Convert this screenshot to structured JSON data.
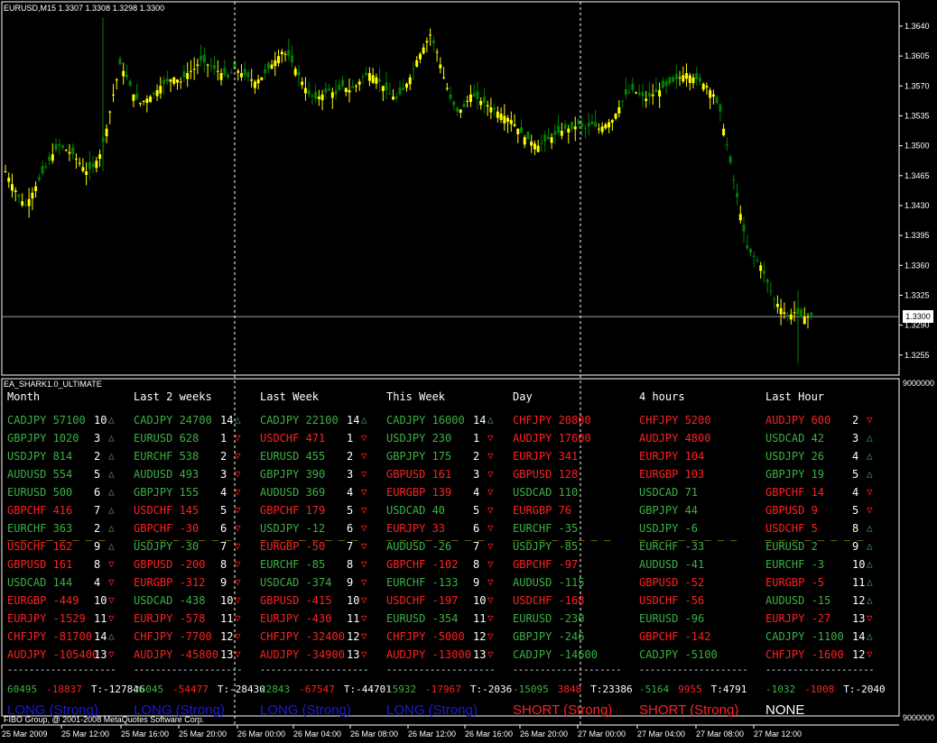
{
  "window": {
    "chart_header": "EURUSD,M15  1.3307 1.3308 1.3298 1.3300",
    "indicator_title": "EA_SHARK1.0_ULTIMATE",
    "copyright": "FIBO Group, @ 2001-2008 MetaQuotes Software Corp.",
    "current_price_badge": "1.3300",
    "indicator_axis_top": "9000000",
    "indicator_axis_bottom": "9000000"
  },
  "colors": {
    "bull": "#ffff00",
    "bear": "#008000",
    "up": "#3cb043",
    "down": "#ff2020",
    "long": "#1a1adc",
    "short": "#ff2020",
    "none": "#ffffff"
  },
  "chart_data": {
    "type": "candlestick",
    "symbol": "EURUSD",
    "timeframe": "M15",
    "y_ticks": [
      "1.3640",
      "1.3605",
      "1.3570",
      "1.3535",
      "1.3500",
      "1.3465",
      "1.3430",
      "1.3395",
      "1.3360",
      "1.3325",
      "1.3290",
      "1.3255"
    ],
    "ylim": [
      1.324,
      1.366
    ],
    "x_ticks": [
      "25 Mar 2009",
      "25 Mar 12:00",
      "25 Mar 16:00",
      "25 Mar 20:00",
      "26 Mar 00:00",
      "26 Mar 04:00",
      "26 Mar 08:00",
      "26 Mar 12:00",
      "26 Mar 16:00",
      "26 Mar 20:00",
      "27 Mar 00:00",
      "27 Mar 04:00",
      "27 Mar 08:00",
      "27 Mar 12:00"
    ],
    "close_path": [
      1.347,
      1.3455,
      1.344,
      1.343,
      1.3445,
      1.346,
      1.3475,
      1.349,
      1.35,
      1.3495,
      1.349,
      1.348,
      1.347,
      1.3475,
      1.349,
      1.352,
      1.356,
      1.3595,
      1.358,
      1.356,
      1.355,
      1.3555,
      1.356,
      1.357,
      1.3575,
      1.358,
      1.3575,
      1.3585,
      1.359,
      1.36,
      1.3595,
      1.359,
      1.3585,
      1.358,
      1.359,
      1.3585,
      1.358,
      1.3575,
      1.358,
      1.359,
      1.36,
      1.361,
      1.3605,
      1.359,
      1.3575,
      1.356,
      1.3555,
      1.356,
      1.3565,
      1.356,
      1.357,
      1.3565,
      1.357,
      1.358,
      1.3585,
      1.358,
      1.357,
      1.356,
      1.3555,
      1.3565,
      1.358,
      1.36,
      1.3615,
      1.363,
      1.361,
      1.358,
      1.3555,
      1.354,
      1.3545,
      1.356,
      1.3555,
      1.355,
      1.3545,
      1.354,
      1.3535,
      1.353,
      1.352,
      1.351,
      1.3505,
      1.35,
      1.3505,
      1.351,
      1.3515,
      1.352,
      1.352,
      1.3525,
      1.352,
      1.3525,
      1.352,
      1.3525,
      1.353,
      1.3545,
      1.356,
      1.3565,
      1.356,
      1.3555,
      1.356,
      1.3565,
      1.357,
      1.3575,
      1.358,
      1.3585,
      1.358,
      1.3575,
      1.357,
      1.356,
      1.354,
      1.35,
      1.346,
      1.342,
      1.338,
      1.337,
      1.336,
      1.334,
      1.332,
      1.331,
      1.33,
      1.3305,
      1.33,
      1.33
    ]
  },
  "columns": [
    {
      "header": "Month",
      "rows": [
        {
          "pair": "CADJPY 57100",
          "rank": "10",
          "dir": "up"
        },
        {
          "pair": "GBPJPY 1020",
          "rank": "3",
          "dir": "up"
        },
        {
          "pair": "USDJPY 814",
          "rank": "2",
          "dir": "up"
        },
        {
          "pair": "AUDUSD 554",
          "rank": "5",
          "dir": "up"
        },
        {
          "pair": "EURUSD 500",
          "rank": "6",
          "dir": "up"
        },
        {
          "pair": "GBPCHF 416",
          "rank": "7",
          "dir": "up"
        },
        {
          "pair": "EURCHF 363",
          "rank": "2",
          "dir": "up"
        },
        {
          "pair": "USDCHF 162",
          "rank": "9",
          "dir": "up"
        },
        {
          "pair": "GBPUSD 161",
          "rank": "8",
          "dir": "down"
        },
        {
          "pair": "USDCAD 144",
          "rank": "4",
          "dir": "down"
        },
        {
          "pair": "EURGBP -449",
          "rank": "10",
          "dir": "down"
        },
        {
          "pair": "EURJPY -1529",
          "rank": "11",
          "dir": "down"
        },
        {
          "pair": "CHFJPY -81700",
          "rank": "14",
          "dir": "up"
        },
        {
          "pair": "AUDJPY -105400",
          "rank": "13",
          "dir": "down"
        }
      ],
      "colors": [
        "up",
        "up",
        "up",
        "up",
        "up",
        "down",
        "up",
        "down",
        "down",
        "up",
        "down",
        "down",
        "down",
        "down"
      ],
      "total_a": "60495",
      "total_b": "-18837",
      "total_t": "T:-127846",
      "signal": "LONG (Strong)",
      "signal_kind": "long"
    },
    {
      "header": "Last 2 weeks",
      "rows": [
        {
          "pair": "CADJPY 24700",
          "rank": "14",
          "dir": "up"
        },
        {
          "pair": "EURUSD 628",
          "rank": "1",
          "dir": "down"
        },
        {
          "pair": "EURCHF 538",
          "rank": "2",
          "dir": "down"
        },
        {
          "pair": "AUDUSD 493",
          "rank": "3",
          "dir": "down"
        },
        {
          "pair": "GBPJPY 155",
          "rank": "4",
          "dir": "down"
        },
        {
          "pair": "USDCHF 145",
          "rank": "5",
          "dir": "down"
        },
        {
          "pair": "GBPCHF -30",
          "rank": "6",
          "dir": "down"
        },
        {
          "pair": "USDJPY -30",
          "rank": "7",
          "dir": "down"
        },
        {
          "pair": "GBPUSD -200",
          "rank": "8",
          "dir": "down"
        },
        {
          "pair": "EURGBP -312",
          "rank": "9",
          "dir": "down"
        },
        {
          "pair": "USDCAD -438",
          "rank": "10",
          "dir": "down"
        },
        {
          "pair": "EURJPY -578",
          "rank": "11",
          "dir": "down"
        },
        {
          "pair": "CHFJPY -7700",
          "rank": "12",
          "dir": "down"
        },
        {
          "pair": "AUDJPY -45800",
          "rank": "13",
          "dir": "down"
        }
      ],
      "colors": [
        "up",
        "up",
        "up",
        "up",
        "up",
        "down",
        "down",
        "up",
        "down",
        "down",
        "up",
        "down",
        "down",
        "down"
      ],
      "total_a": "26045",
      "total_b": "-54477",
      "total_t": "T:-28430",
      "signal": "LONG (Strong)",
      "signal_kind": "long"
    },
    {
      "header": "Last Week",
      "rows": [
        {
          "pair": "CADJPY 22100",
          "rank": "14",
          "dir": "up"
        },
        {
          "pair": "USDCHF 471",
          "rank": "1",
          "dir": "down"
        },
        {
          "pair": "EURUSD 455",
          "rank": "2",
          "dir": "down"
        },
        {
          "pair": "GBPJPY 390",
          "rank": "3",
          "dir": "down"
        },
        {
          "pair": "AUDUSD 369",
          "rank": "4",
          "dir": "down"
        },
        {
          "pair": "GBPCHF 179",
          "rank": "5",
          "dir": "down"
        },
        {
          "pair": "USDJPY -12",
          "rank": "6",
          "dir": "down"
        },
        {
          "pair": "EURGBP -50",
          "rank": "7",
          "dir": "down"
        },
        {
          "pair": "EURCHF -85",
          "rank": "8",
          "dir": "down"
        },
        {
          "pair": "USDCAD -374",
          "rank": "9",
          "dir": "down"
        },
        {
          "pair": "GBPUSD -415",
          "rank": "10",
          "dir": "down"
        },
        {
          "pair": "EURJPY -430",
          "rank": "11",
          "dir": "down"
        },
        {
          "pair": "CHFJPY -32400",
          "rank": "12",
          "dir": "down"
        },
        {
          "pair": "AUDJPY -34900",
          "rank": "13",
          "dir": "down"
        }
      ],
      "colors": [
        "up",
        "down",
        "up",
        "up",
        "up",
        "down",
        "up",
        "down",
        "up",
        "up",
        "down",
        "down",
        "down",
        "down"
      ],
      "total_a": "22843",
      "total_b": "-67547",
      "total_t": "T:-44701",
      "signal": "LONG (Strong)",
      "signal_kind": "long"
    },
    {
      "header": "This Week",
      "rows": [
        {
          "pair": "CADJPY 16000",
          "rank": "14",
          "dir": "up"
        },
        {
          "pair": "USDJPY 230",
          "rank": "1",
          "dir": "down"
        },
        {
          "pair": "GBPJPY 175",
          "rank": "2",
          "dir": "down"
        },
        {
          "pair": "GBPUSD 161",
          "rank": "3",
          "dir": "down"
        },
        {
          "pair": "EURGBP 139",
          "rank": "4",
          "dir": "down"
        },
        {
          "pair": "USDCAD 40",
          "rank": "5",
          "dir": "down"
        },
        {
          "pair": "EURJPY 33",
          "rank": "6",
          "dir": "down"
        },
        {
          "pair": "AUDUSD -26",
          "rank": "7",
          "dir": "down"
        },
        {
          "pair": "GBPCHF -102",
          "rank": "8",
          "dir": "down"
        },
        {
          "pair": "EURCHF -133",
          "rank": "9",
          "dir": "down"
        },
        {
          "pair": "USDCHF -197",
          "rank": "10",
          "dir": "down"
        },
        {
          "pair": "EURUSD -354",
          "rank": "11",
          "dir": "down"
        },
        {
          "pair": "CHFJPY -5000",
          "rank": "12",
          "dir": "down"
        },
        {
          "pair": "AUDJPY -13000",
          "rank": "13",
          "dir": "down"
        }
      ],
      "colors": [
        "up",
        "up",
        "up",
        "down",
        "down",
        "up",
        "down",
        "up",
        "down",
        "up",
        "down",
        "up",
        "down",
        "down"
      ],
      "total_a": "15932",
      "total_b": "-17967",
      "total_t": "T:-2036",
      "signal": "LONG (Strong)",
      "signal_kind": "long"
    },
    {
      "header": "Day",
      "rows": [
        {
          "pair": "CHFJPY 20800",
          "rank": "",
          "dir": ""
        },
        {
          "pair": "AUDJPY 17600",
          "rank": "",
          "dir": ""
        },
        {
          "pair": "EURJPY 341",
          "rank": "",
          "dir": ""
        },
        {
          "pair": "GBPUSD 128",
          "rank": "",
          "dir": ""
        },
        {
          "pair": "USDCAD 110",
          "rank": "",
          "dir": ""
        },
        {
          "pair": "EURGBP 76",
          "rank": "",
          "dir": ""
        },
        {
          "pair": "EURCHF -35",
          "rank": "",
          "dir": ""
        },
        {
          "pair": "USDJPY -85",
          "rank": "",
          "dir": ""
        },
        {
          "pair": "GBPCHF -97",
          "rank": "",
          "dir": ""
        },
        {
          "pair": "AUDUSD -115",
          "rank": "",
          "dir": ""
        },
        {
          "pair": "USDCHF -168",
          "rank": "",
          "dir": ""
        },
        {
          "pair": "EURUSD -230",
          "rank": "",
          "dir": ""
        },
        {
          "pair": "GBPJPY -246",
          "rank": "",
          "dir": ""
        },
        {
          "pair": "CADJPY -14600",
          "rank": "",
          "dir": ""
        }
      ],
      "colors": [
        "down",
        "down",
        "down",
        "down",
        "up",
        "down",
        "up",
        "up",
        "down",
        "up",
        "down",
        "up",
        "up",
        "up"
      ],
      "total_a": "-15095",
      "total_b": "3848",
      "total_t": "T:23386",
      "signal": "SHORT (Strong)",
      "signal_kind": "short"
    },
    {
      "header": "4 hours",
      "rows": [
        {
          "pair": "CHFJPY 5200",
          "rank": "",
          "dir": ""
        },
        {
          "pair": "AUDJPY 4800",
          "rank": "",
          "dir": ""
        },
        {
          "pair": "EURJPY 104",
          "rank": "",
          "dir": ""
        },
        {
          "pair": "EURGBP 103",
          "rank": "",
          "dir": ""
        },
        {
          "pair": "USDCAD 71",
          "rank": "",
          "dir": ""
        },
        {
          "pair": "GBPJPY 44",
          "rank": "",
          "dir": ""
        },
        {
          "pair": "USDJPY -6",
          "rank": "",
          "dir": ""
        },
        {
          "pair": "EURCHF -33",
          "rank": "",
          "dir": ""
        },
        {
          "pair": "AUDUSD -41",
          "rank": "",
          "dir": ""
        },
        {
          "pair": "GBPUSD -52",
          "rank": "",
          "dir": ""
        },
        {
          "pair": "USDCHF -56",
          "rank": "",
          "dir": ""
        },
        {
          "pair": "EURUSD -96",
          "rank": "",
          "dir": ""
        },
        {
          "pair": "GBPCHF -142",
          "rank": "",
          "dir": ""
        },
        {
          "pair": "CADJPY -5100",
          "rank": "",
          "dir": ""
        }
      ],
      "colors": [
        "down",
        "down",
        "down",
        "down",
        "up",
        "up",
        "up",
        "up",
        "up",
        "down",
        "down",
        "up",
        "down",
        "up"
      ],
      "total_a": "-5164",
      "total_b": "9955",
      "total_t": "T:4791",
      "signal": "SHORT (Strong)",
      "signal_kind": "short"
    },
    {
      "header": "Last Hour",
      "rows": [
        {
          "pair": "AUDJPY 600",
          "rank": "2",
          "dir": "down"
        },
        {
          "pair": "USDCAD 42",
          "rank": "3",
          "dir": "up"
        },
        {
          "pair": "USDJPY 26",
          "rank": "4",
          "dir": "up"
        },
        {
          "pair": "GBPJPY 19",
          "rank": "5",
          "dir": "up"
        },
        {
          "pair": "GBPCHF 14",
          "rank": "4",
          "dir": "down"
        },
        {
          "pair": "GBPUSD 9",
          "rank": "5",
          "dir": "down"
        },
        {
          "pair": "USDCHF 5",
          "rank": "8",
          "dir": "up"
        },
        {
          "pair": "EURUSD 2",
          "rank": "9",
          "dir": "up"
        },
        {
          "pair": "EURCHF -3",
          "rank": "10",
          "dir": "up"
        },
        {
          "pair": "EURGBP -5",
          "rank": "11",
          "dir": "up"
        },
        {
          "pair": "AUDUSD -15",
          "rank": "12",
          "dir": "up"
        },
        {
          "pair": "EURJPY -27",
          "rank": "13",
          "dir": "down"
        },
        {
          "pair": "CADJPY -1100",
          "rank": "14",
          "dir": "up"
        },
        {
          "pair": "CHFJPY -1600",
          "rank": "12",
          "dir": "down"
        }
      ],
      "colors": [
        "down",
        "up",
        "up",
        "up",
        "down",
        "down",
        "down",
        "up",
        "up",
        "down",
        "up",
        "down",
        "up",
        "down"
      ],
      "total_a": "-1032",
      "total_b": "-1008",
      "total_t": "T:-2040",
      "signal": "NONE",
      "signal_kind": "none"
    }
  ],
  "dash_line": "--------------------",
  "mid_dash": "_ _ _ _ _ _ _ _"
}
